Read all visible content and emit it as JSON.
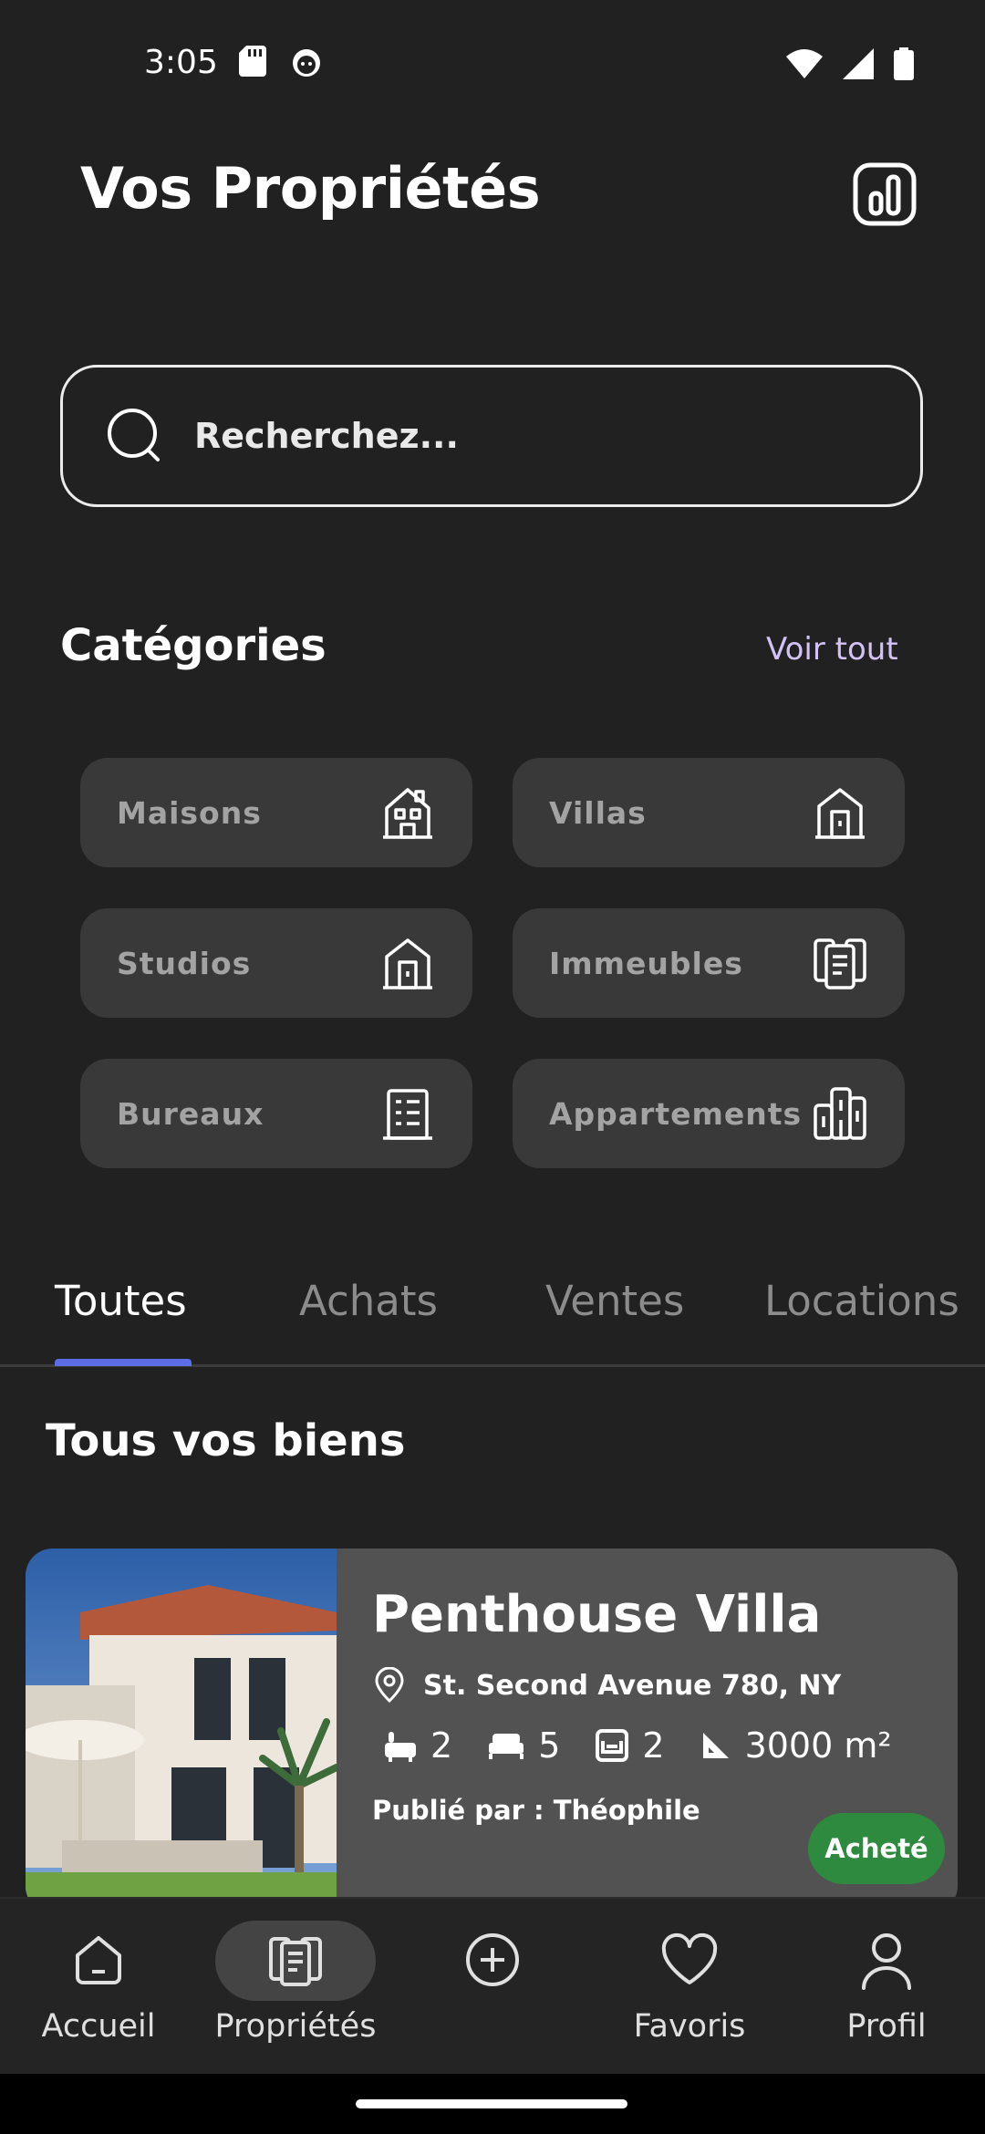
{
  "status": {
    "time": "3:05"
  },
  "header": {
    "title": "Vos Propriétés"
  },
  "search": {
    "placeholder": "Recherchez..."
  },
  "categories": {
    "title": "Catégories",
    "see_all": "Voir tout",
    "items": [
      {
        "label": "Maisons",
        "icon": "house-icon"
      },
      {
        "label": "Villas",
        "icon": "villa-icon"
      },
      {
        "label": "Studios",
        "icon": "studio-icon"
      },
      {
        "label": "Immeubles",
        "icon": "buildings-icon"
      },
      {
        "label": "Bureaux",
        "icon": "office-icon"
      },
      {
        "label": "Appartements",
        "icon": "apartments-icon"
      }
    ]
  },
  "tabs": [
    {
      "label": "Toutes",
      "active": true
    },
    {
      "label": "Achats",
      "active": false
    },
    {
      "label": "Ventes",
      "active": false
    },
    {
      "label": "Locations",
      "active": false
    }
  ],
  "list": {
    "title": "Tous vos biens",
    "properties": [
      {
        "name": "Penthouse Villa",
        "address": "St. Second Avenue 780, NY",
        "baths": "2",
        "beds": "5",
        "sofas": "2",
        "area": "3000 m²",
        "published_by": "Publié par : Théophile",
        "status": "Acheté",
        "status_color": "#2e8a3e"
      }
    ]
  },
  "nav": [
    {
      "label": "Accueil",
      "icon": "home-icon"
    },
    {
      "label": "Propriétés",
      "icon": "properties-icon",
      "active": true
    },
    {
      "label": "",
      "icon": "add-circle-icon"
    },
    {
      "label": "Favoris",
      "icon": "heart-icon"
    },
    {
      "label": "Profil",
      "icon": "person-icon"
    }
  ],
  "colors": {
    "background": "#212121",
    "accent": "#5b6ee6",
    "link": "#d2c2f5"
  }
}
